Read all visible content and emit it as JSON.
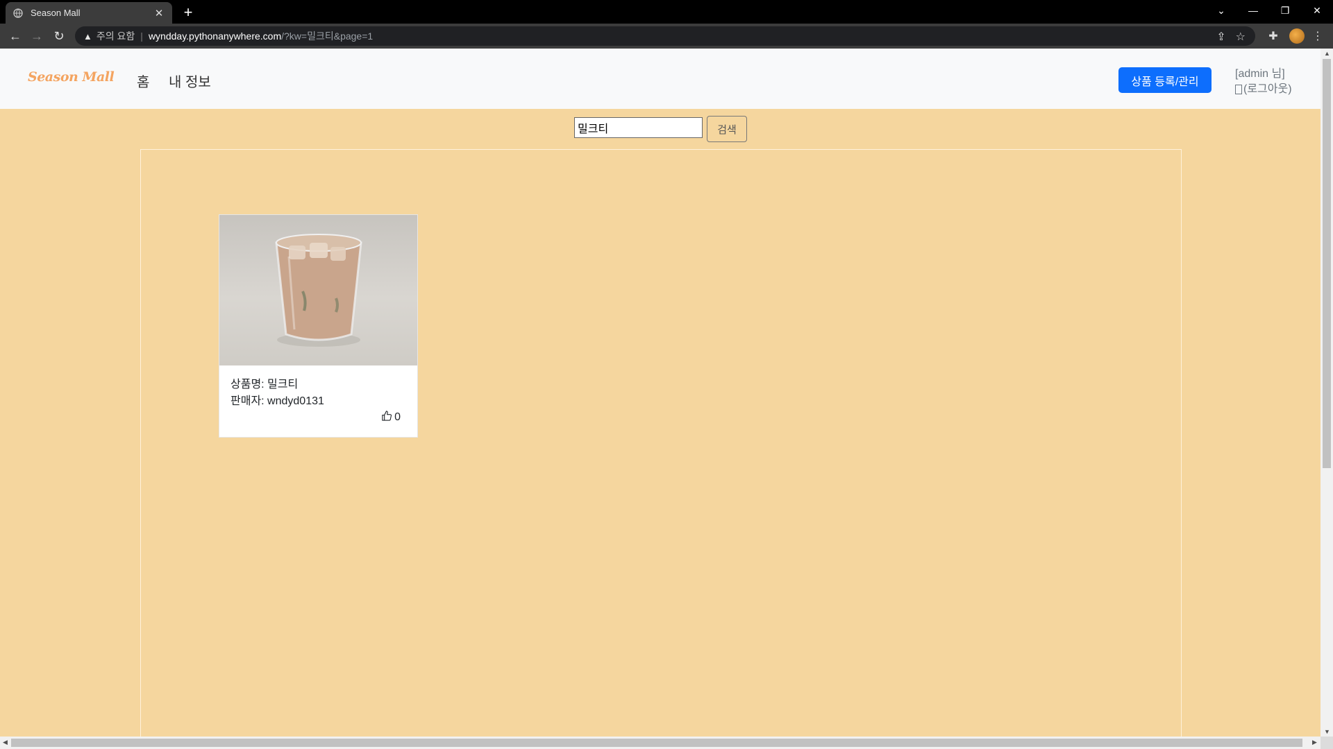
{
  "browser": {
    "tab_title": "Season Mall",
    "new_tab": "+",
    "security_label": "주의 요함",
    "url_host": "wyndday.pythonanywhere.com",
    "url_path": "/?kw=밀크티&page=1"
  },
  "navbar": {
    "logo": "Season Mall",
    "links": [
      "홈",
      "내 정보"
    ],
    "register_button": "상품 등록/관리",
    "user": "[admin 님]",
    "logout": "(로그아웃)"
  },
  "search": {
    "value": "밀크티",
    "button": "검색"
  },
  "products": [
    {
      "name_line": "상품명: 밀크티",
      "seller_line": "판매자: wndyd0131",
      "likes": "0"
    }
  ],
  "colors": {
    "page_bg": "#f5d69e",
    "primary": "#0d6efd",
    "logo": "#f4a460"
  }
}
